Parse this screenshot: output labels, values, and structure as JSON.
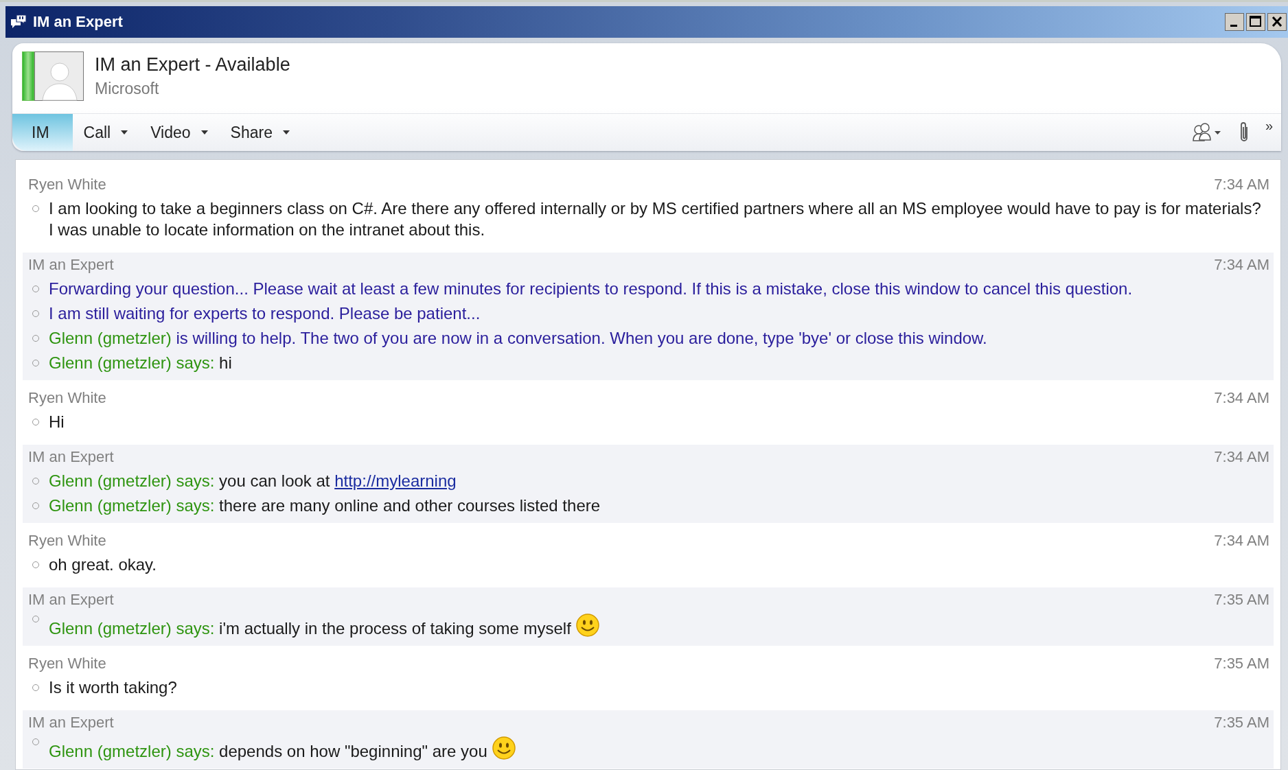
{
  "window": {
    "title": "IM an Expert"
  },
  "contact": {
    "name": "IM an Expert - Available",
    "company": "Microsoft"
  },
  "toolbar": {
    "items": [
      {
        "label": "IM",
        "selected": true,
        "dropdown": false
      },
      {
        "label": "Call",
        "selected": false,
        "dropdown": true
      },
      {
        "label": "Video",
        "selected": false,
        "dropdown": true
      },
      {
        "label": "Share",
        "selected": false,
        "dropdown": true
      }
    ],
    "overflow": "»"
  },
  "messages": [
    {
      "sender": "Ryen White",
      "time": "7:34 AM",
      "shaded": false,
      "lines": [
        {
          "emoticon": false,
          "parts": [
            {
              "kind": "text",
              "text": "I am looking to take a beginners class on C#. Are there any offered internally or by MS certified partners where all an MS employee would have to pay is for materials? I was unable to locate information on the intranet about this."
            }
          ]
        }
      ]
    },
    {
      "sender": "IM an Expert",
      "time": "7:34 AM",
      "shaded": true,
      "lines": [
        {
          "emoticon": false,
          "parts": [
            {
              "kind": "system",
              "text": "Forwarding your question... Please wait at least a few minutes for recipients to respond. If this is a mistake, close this window to cancel this question."
            }
          ]
        },
        {
          "emoticon": false,
          "parts": [
            {
              "kind": "system",
              "text": "I am still waiting for experts to respond. Please be patient..."
            }
          ]
        },
        {
          "emoticon": false,
          "parts": [
            {
              "kind": "speaker",
              "text": "Glenn (gmetzler)"
            },
            {
              "kind": "system",
              "text": " is willing to help. The two of you are now in a conversation. When you are done, type 'bye' or close this window."
            }
          ]
        },
        {
          "emoticon": false,
          "parts": [
            {
              "kind": "speaker",
              "text": "Glenn (gmetzler) says:"
            },
            {
              "kind": "text",
              "text": " hi"
            }
          ]
        }
      ]
    },
    {
      "sender": "Ryen White",
      "time": "7:34 AM",
      "shaded": false,
      "lines": [
        {
          "emoticon": false,
          "parts": [
            {
              "kind": "text",
              "text": "Hi"
            }
          ]
        }
      ]
    },
    {
      "sender": "IM an Expert",
      "time": "7:34 AM",
      "shaded": true,
      "lines": [
        {
          "emoticon": false,
          "parts": [
            {
              "kind": "speaker",
              "text": "Glenn (gmetzler) says:"
            },
            {
              "kind": "text",
              "text": " you can look at "
            },
            {
              "kind": "link",
              "text": "http://mylearning"
            }
          ]
        },
        {
          "emoticon": false,
          "parts": [
            {
              "kind": "speaker",
              "text": "Glenn (gmetzler) says:"
            },
            {
              "kind": "text",
              "text": " there are many online and other courses listed there"
            }
          ]
        }
      ]
    },
    {
      "sender": "Ryen White",
      "time": "7:34 AM",
      "shaded": false,
      "lines": [
        {
          "emoticon": false,
          "parts": [
            {
              "kind": "text",
              "text": "oh great. okay."
            }
          ]
        }
      ]
    },
    {
      "sender": "IM an Expert",
      "time": "7:35 AM",
      "shaded": true,
      "lines": [
        {
          "emoticon": true,
          "parts": [
            {
              "kind": "speaker",
              "text": "Glenn (gmetzler) says:"
            },
            {
              "kind": "text",
              "text": " i'm actually in the process of taking some myself"
            }
          ]
        }
      ]
    },
    {
      "sender": "Ryen White",
      "time": "7:35 AM",
      "shaded": false,
      "lines": [
        {
          "emoticon": false,
          "parts": [
            {
              "kind": "text",
              "text": "Is it worth taking?"
            }
          ]
        }
      ]
    },
    {
      "sender": "IM an Expert",
      "time": "7:35 AM",
      "shaded": true,
      "lines": [
        {
          "emoticon": true,
          "parts": [
            {
              "kind": "speaker",
              "text": "Glenn (gmetzler) says:"
            },
            {
              "kind": "text",
              "text": " depends on how \"beginning\" are you"
            }
          ]
        }
      ]
    }
  ]
}
